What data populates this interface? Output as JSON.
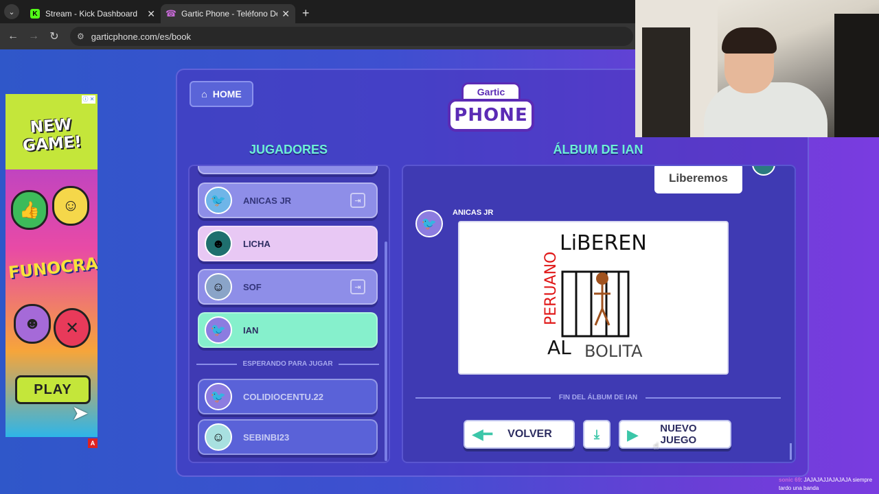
{
  "browser": {
    "tabs": [
      {
        "title": "Stream - Kick Dashboard",
        "favicon": "K",
        "active": false
      },
      {
        "title": "Gartic Phone - Teléfono Descon",
        "favicon": "☎",
        "active": true
      }
    ],
    "url": "garticphone.com/es/book"
  },
  "ad": {
    "headline": "NEW GAME!",
    "brand": "FUNOCRACY",
    "cta": "PLAY",
    "badge": "A"
  },
  "game": {
    "home_label": "HOME",
    "logo_top": "Gartic",
    "logo_main": "PHONE",
    "players_title": "JUGADORES",
    "album_title": "ÁLBUM DE IAN",
    "players": [
      {
        "name": "ANICAS JR",
        "style": "light",
        "exit": true
      },
      {
        "name": "LICHA",
        "style": "pink",
        "exit": false
      },
      {
        "name": "SOF",
        "style": "light",
        "exit": true
      },
      {
        "name": "IAN",
        "style": "green",
        "exit": false
      }
    ],
    "waiting_label": "ESPERANDO PARA JUGAR",
    "waiting_players": [
      {
        "name": "COLIDIOCENTU.22"
      },
      {
        "name": "SEBINBI23"
      }
    ]
  },
  "album": {
    "bubble_text": "Liberemos",
    "author": "ANICAS JR",
    "drawing_text": {
      "top_line": "LiBEREN",
      "side_word": "PERUANO",
      "bottom_line_a": "AL",
      "bottom_line_b": "BOLITA"
    },
    "end_label": "FIN DEL ÁLBUM DE IAN",
    "back_button": "VOLVER",
    "new_game_button_line1": "NUEVO",
    "new_game_button_line2": "JUEGO"
  },
  "chat": {
    "user": "sonic 69",
    "message": ": JAJAJAJJAJAJAJA siempre tardo una banda"
  }
}
